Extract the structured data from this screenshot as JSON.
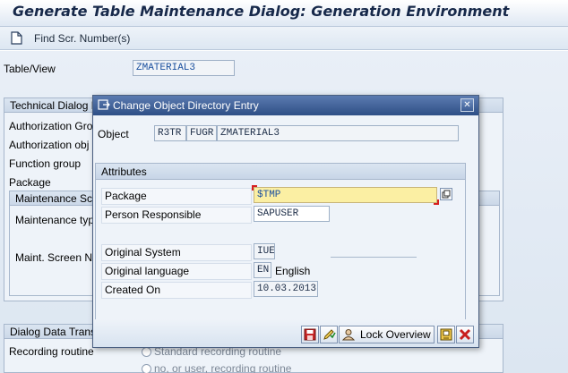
{
  "window": {
    "title": "Generate Table Maintenance Dialog: Generation Environment"
  },
  "toolbar": {
    "find_label": "Find Scr. Number(s)"
  },
  "main": {
    "table_view_label": "Table/View",
    "table_view_value": "ZMATERIAL3",
    "tech_group_title": "Technical Dialog D",
    "auth_group_label": "Authorization Gro",
    "auth_object_label": "Authorization obj",
    "function_group_label": "Function group",
    "package_label": "Package",
    "maint_screens_title": "Maintenance Scr",
    "maint_type_label": "Maintenance typ",
    "maint_screen_no_label": "Maint. Screen N",
    "dialog_data_title": "Dialog Data Trans",
    "recording_label": "Recording routine",
    "radio_standard": "Standard recording routine",
    "radio_no_user": "no, or user, recording routine"
  },
  "modal": {
    "title": "Change Object Directory Entry",
    "object_label": "Object",
    "object_pgmid": "R3TR",
    "object_type": "FUGR",
    "object_name": "ZMATERIAL3",
    "attributes_title": "Attributes",
    "package_label": "Package",
    "package_value": "$TMP",
    "person_label": "Person Responsible",
    "person_value": "SAPUSER",
    "orig_system_label": "Original System",
    "orig_system_value": "IUE",
    "orig_lang_label": "Original language",
    "orig_lang_code": "EN",
    "orig_lang_name": "English",
    "created_label": "Created On",
    "created_value": "10.03.2013",
    "lock_overview_label": "Lock Overview"
  },
  "colors": {
    "title_blue": "#17294a",
    "modal_header": "#2e4f86",
    "required_yellow": "#fbefa3",
    "cancel_red": "#c81e1e"
  }
}
